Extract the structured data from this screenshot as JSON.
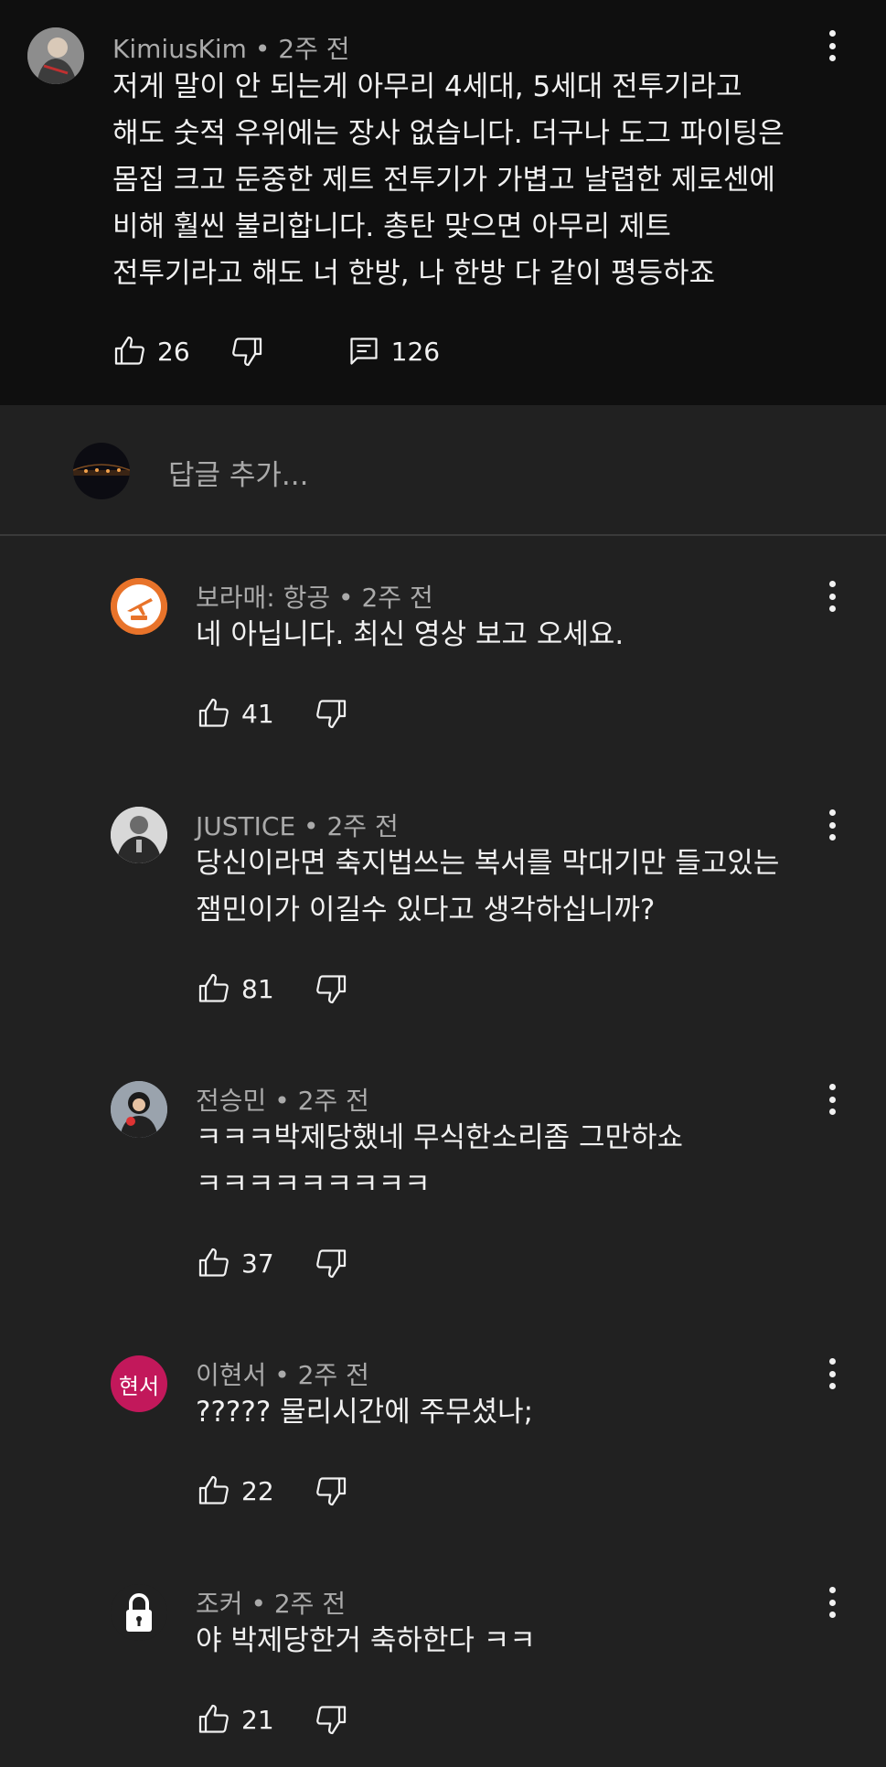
{
  "main_comment": {
    "author": "KimiusKim",
    "time": "2주 전",
    "text": "저게 말이 안 되는게 아무리 4세대, 5세대 전투기라고\n해도 숫적 우위에는 장사 없습니다. 더구나 도그 파이팅은\n몸집 크고 둔중한 제트 전투기가 가볍고 날렵한 제로센에\n비해 훨씬 불리합니다. 총탄 맞으면 아무리 제트\n전투기라고 해도 너 한방, 나 한방 다 같이 평등하죠",
    "likes": "26",
    "replies": "126"
  },
  "reply_box": {
    "placeholder": "답글 추가..."
  },
  "separator": "•",
  "replies": [
    {
      "author": "보라매: 항공",
      "time": "2주 전",
      "text": "네 아닙니다. 최신 영상 보고 오세요.",
      "likes": "41",
      "avatar_text": ""
    },
    {
      "author": "JUSTICE",
      "time": "2주 전",
      "text": "당신이라면 축지법쓰는 복서를 막대기만 들고있는\n잼민이가 이길수 있다고 생각하십니까?",
      "likes": "81",
      "avatar_text": ""
    },
    {
      "author": "전승민",
      "time": "2주 전",
      "text": "ㅋㅋㅋ박제당했네 무식한소리좀 그만하쇼\nㅋㅋㅋㅋㅋㅋㅋㅋㅋ",
      "likes": "37",
      "avatar_text": ""
    },
    {
      "author": "이현서",
      "time": "2주 전",
      "text": "????? 물리시간에 주무셨나;",
      "likes": "22",
      "avatar_text": "현서"
    },
    {
      "author": "조커",
      "time": "2주 전",
      "text": "야 박제당한거 축하한다 ㅋㅋ",
      "likes": "21",
      "avatar_text": ""
    }
  ],
  "colors": {
    "background": "#212121",
    "top_background": "#0f0f0f",
    "secondary_text": "#aaaaaa",
    "avatar_orange": "#e8732a",
    "avatar_pink": "#c2185b"
  },
  "icons": [
    "thumbs-up-icon",
    "thumbs-down-icon",
    "comment-icon",
    "more-vert-icon",
    "lock-icon",
    "airplane-icon"
  ]
}
